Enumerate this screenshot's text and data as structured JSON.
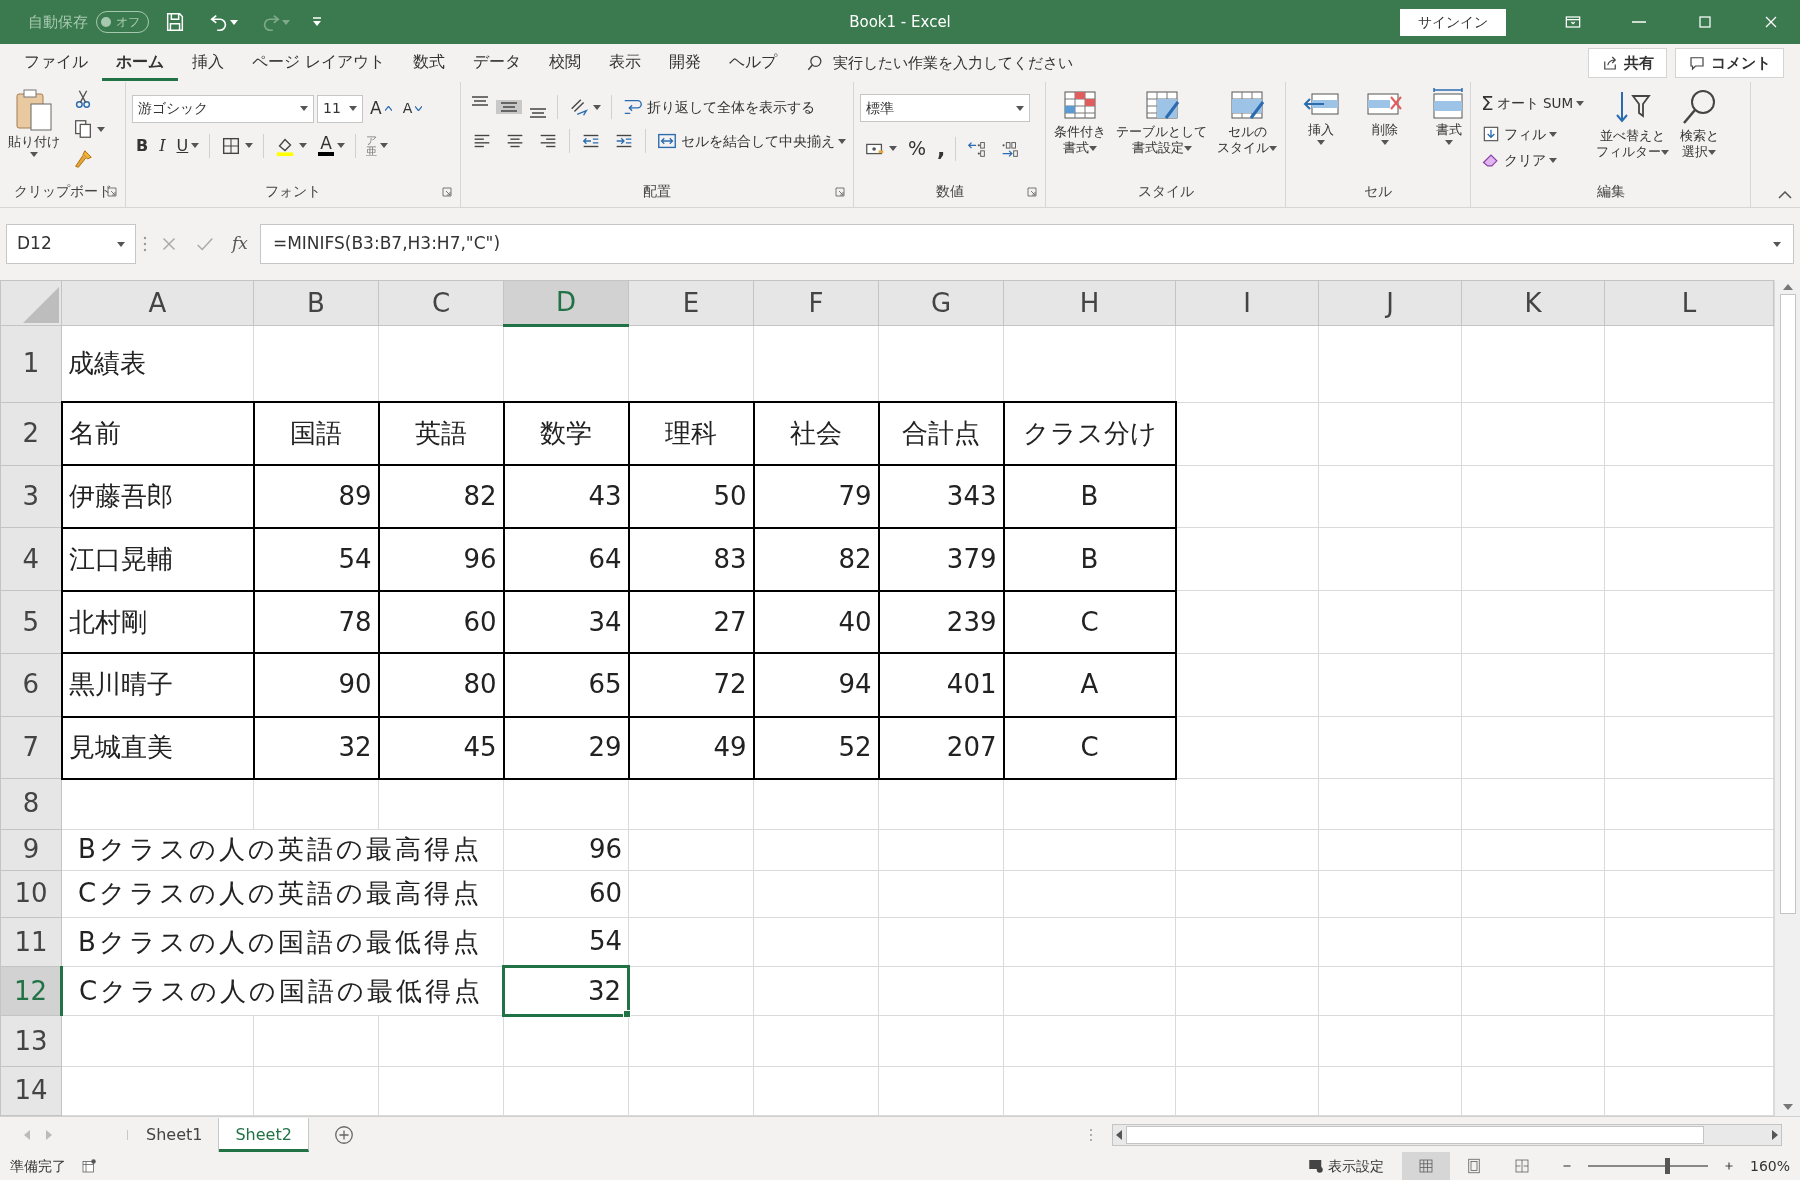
{
  "title_bar": {
    "autosave_label": "自動保存",
    "autosave_state": "オフ",
    "title": "Book1  -  Excel",
    "signin": "サインイン"
  },
  "ribbon_tabs": [
    {
      "label": "ファイル",
      "selected": false
    },
    {
      "label": "ホーム",
      "selected": true
    },
    {
      "label": "挿入",
      "selected": false
    },
    {
      "label": "ページ レイアウト",
      "selected": false
    },
    {
      "label": "数式",
      "selected": false
    },
    {
      "label": "データ",
      "selected": false
    },
    {
      "label": "校閲",
      "selected": false
    },
    {
      "label": "表示",
      "selected": false
    },
    {
      "label": "開発",
      "selected": false
    },
    {
      "label": "ヘルプ",
      "selected": false
    }
  ],
  "tell_me": "実行したい作業を入力してください",
  "share": "共有",
  "comment": "コメント",
  "ribbon": {
    "clipboard": {
      "label": "クリップボード",
      "paste": "貼り付け"
    },
    "font": {
      "label": "フォント",
      "face": "游ゴシック",
      "size": "11",
      "grow": "A",
      "shrink": "A",
      "styles": [
        "B",
        "I",
        "U"
      ],
      "color_letter": "A",
      "phonetic": [
        "ア",
        "亜"
      ]
    },
    "alignment": {
      "label": "配置",
      "wrap": "折り返して全体を表示する",
      "merge": "セルを結合して中央揃え"
    },
    "number": {
      "label": "数値",
      "format": "標準",
      "percent": "%",
      "comma": ","
    },
    "styles": {
      "label": "スタイル",
      "buttons": [
        [
          "条件付き",
          "書式"
        ],
        [
          "テーブルとして",
          "書式設定"
        ],
        [
          "セルの",
          "スタイル"
        ]
      ]
    },
    "cells": {
      "label": "セル",
      "buttons": [
        "挿入",
        "削除",
        "書式"
      ]
    },
    "editing": {
      "label": "編集",
      "sigma": "Σ",
      "autosum": "オート SUM",
      "fill": "フィル",
      "clear": "クリア",
      "sort": [
        "並べ替えと",
        "フィルター"
      ],
      "find": [
        "検索と",
        "選択"
      ]
    }
  },
  "formula_bar": {
    "name_box": "D12",
    "fx": "fx",
    "formula": "=MINIFS(B3:B7,H3:H7,\"C\")"
  },
  "sheet": {
    "columns": [
      {
        "label": "A",
        "selected": false
      },
      {
        "label": "B",
        "selected": false
      },
      {
        "label": "C",
        "selected": false
      },
      {
        "label": "D",
        "selected": true
      },
      {
        "label": "E",
        "selected": false
      },
      {
        "label": "F",
        "selected": false
      },
      {
        "label": "G",
        "selected": false
      },
      {
        "label": "H",
        "selected": false
      },
      {
        "label": "I",
        "selected": false
      },
      {
        "label": "J",
        "selected": false
      },
      {
        "label": "K",
        "selected": false
      },
      {
        "label": "L",
        "selected": false
      }
    ],
    "row_numbers": [
      {
        "label": "1",
        "selected": false
      },
      {
        "label": "2",
        "selected": false
      },
      {
        "label": "3",
        "selected": false
      },
      {
        "label": "4",
        "selected": false
      },
      {
        "label": "5",
        "selected": false
      },
      {
        "label": "6",
        "selected": false
      },
      {
        "label": "7",
        "selected": false
      },
      {
        "label": "8",
        "selected": false
      },
      {
        "label": "9",
        "selected": false
      },
      {
        "label": "10",
        "selected": false
      },
      {
        "label": "11",
        "selected": false
      },
      {
        "label": "12",
        "selected": true
      },
      {
        "label": "13",
        "selected": false
      },
      {
        "label": "14",
        "selected": false
      }
    ],
    "title": "成績表",
    "header": [
      "名前",
      "国語",
      "英語",
      "数学",
      "理科",
      "社会",
      "合計点",
      "クラス分け"
    ],
    "records": [
      [
        "伊藤吾郎",
        "89",
        "82",
        "43",
        "50",
        "79",
        "343",
        "B"
      ],
      [
        "江口晃輔",
        "54",
        "96",
        "64",
        "83",
        "82",
        "379",
        "B"
      ],
      [
        "北村剛",
        "78",
        "60",
        "34",
        "27",
        "40",
        "239",
        "C"
      ],
      [
        "黒川晴子",
        "90",
        "80",
        "65",
        "72",
        "94",
        "401",
        "A"
      ],
      [
        "見城直美",
        "32",
        "45",
        "29",
        "49",
        "52",
        "207",
        "C"
      ]
    ],
    "results": [
      {
        "label": "Bクラスの人の英語の最高得点",
        "value": "96",
        "selected": false
      },
      {
        "label": "Cクラスの人の英語の最高得点",
        "value": "60",
        "selected": false
      },
      {
        "label": "Bクラスの人の国語の最低得点",
        "value": "54",
        "selected": false
      },
      {
        "label": "Cクラスの人の国語の最低得点",
        "value": "32",
        "selected": true
      }
    ]
  },
  "sheet_tabs": [
    {
      "label": "Sheet1",
      "selected": false
    },
    {
      "label": "Sheet2",
      "selected": true
    }
  ],
  "status_bar": {
    "ready": "準備完了",
    "display_settings": "表示設定",
    "zoom": {
      "level": 0.66,
      "reading": "160%"
    }
  }
}
